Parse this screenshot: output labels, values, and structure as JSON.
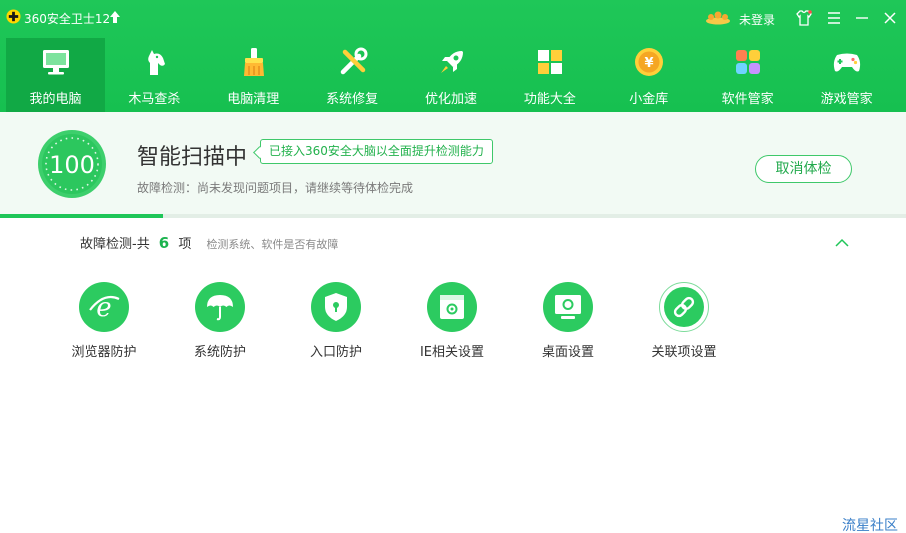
{
  "app": {
    "title": "360安全卫士12",
    "login_text": "未登录",
    "brand_color": "#1fc758",
    "icons": {
      "logo": "360-logo-icon",
      "upgrade": "upgrade-arrow-icon",
      "vip": "vip-crown-icon",
      "skin": "skin-shirt-icon",
      "menu": "menu-icon",
      "minimize": "minimize-icon",
      "close": "close-icon"
    }
  },
  "nav": {
    "items": [
      {
        "label": "我的电脑",
        "icon": "monitor-icon",
        "active": true
      },
      {
        "label": "木马查杀",
        "icon": "horse-icon",
        "active": false
      },
      {
        "label": "电脑清理",
        "icon": "broom-icon",
        "active": false
      },
      {
        "label": "系统修复",
        "icon": "repair-tools-icon",
        "active": false
      },
      {
        "label": "优化加速",
        "icon": "rocket-icon",
        "active": false
      },
      {
        "label": "功能大全",
        "icon": "grid-apps-icon",
        "active": false
      },
      {
        "label": "小金库",
        "icon": "gold-coin-icon",
        "active": false
      },
      {
        "label": "软件管家",
        "icon": "software-manager-icon",
        "active": false
      },
      {
        "label": "游戏管家",
        "icon": "gamepad-icon",
        "active": false
      }
    ]
  },
  "scan": {
    "score": "100",
    "title": "智能扫描中",
    "brain_tag": "已接入360安全大脑以全面提升检测能力",
    "subtitle": "故障检测：尚未发现问题项目，请继续等待体检完成",
    "cancel_label": "取消体检",
    "progress": 0.18
  },
  "detection": {
    "title": "故障检测-共",
    "count": "6",
    "unit": "项",
    "description": "检测系统、软件是否有故障",
    "collapse_icon": "chevron-up-icon",
    "items": [
      {
        "label": "浏览器防护",
        "icon": "ie-browser-icon"
      },
      {
        "label": "系统防护",
        "icon": "umbrella-icon"
      },
      {
        "label": "入口防护",
        "icon": "shield-lock-icon"
      },
      {
        "label": "IE相关设置",
        "icon": "ie-settings-icon"
      },
      {
        "label": "桌面设置",
        "icon": "desktop-settings-icon"
      },
      {
        "label": "关联项设置",
        "icon": "link-icon"
      }
    ]
  },
  "watermark": "流星社区"
}
